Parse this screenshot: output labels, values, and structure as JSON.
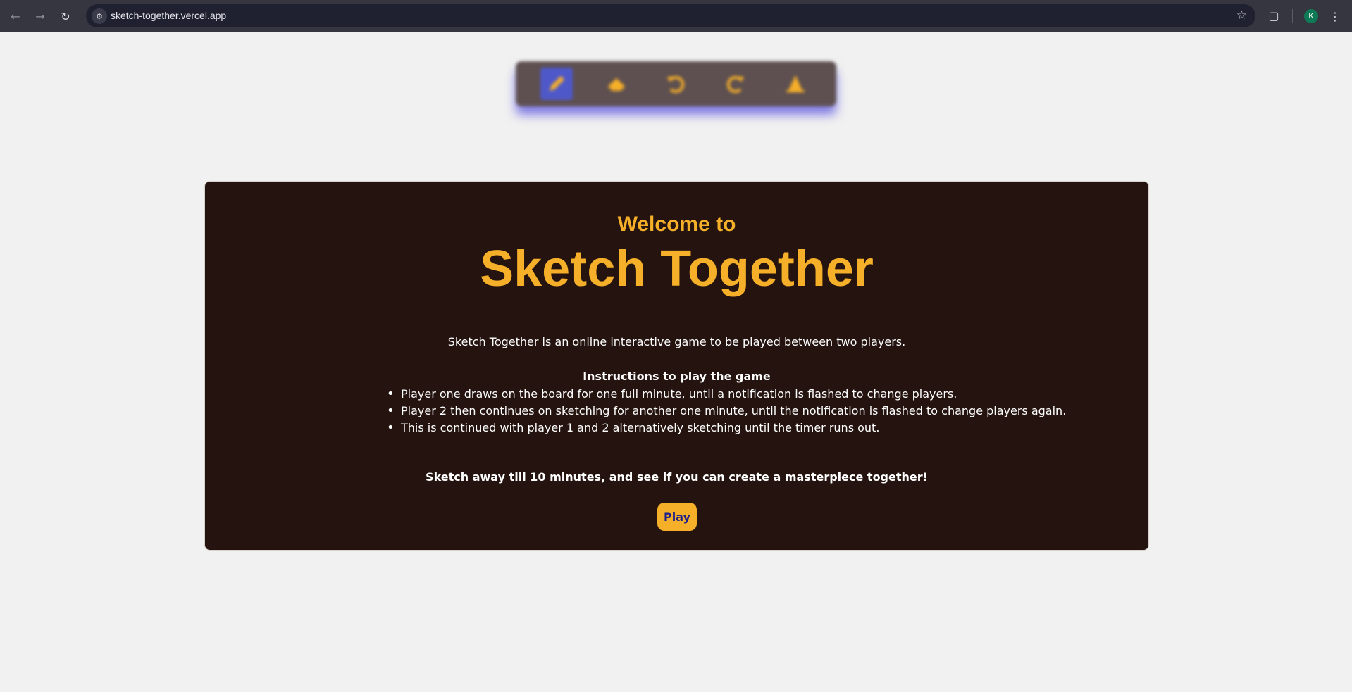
{
  "browser": {
    "url": "sketch-together.vercel.app",
    "profile_initial": "K",
    "icons": [
      "back-icon",
      "forward-icon",
      "reload-icon",
      "site-info-icon",
      "bookmark-star-icon",
      "extensions-icon",
      "more-menu-icon"
    ]
  },
  "toolbar": {
    "tools": [
      {
        "name": "pencil-tool",
        "icon": "pencil-icon",
        "active": true
      },
      {
        "name": "eraser-tool",
        "icon": "eraser-icon",
        "active": false
      },
      {
        "name": "undo-tool",
        "icon": "undo-icon",
        "active": false
      },
      {
        "name": "redo-tool",
        "icon": "redo-icon",
        "active": false
      },
      {
        "name": "clear-tool",
        "icon": "cone-icon",
        "active": false
      }
    ],
    "colors": {
      "background": "#5e5050",
      "icon": "#f6af28",
      "active": "#4f58c9",
      "glow": "#5c54e0"
    }
  },
  "card": {
    "welcome": "Welcome to",
    "title": "Sketch Together",
    "intro": "Sketch Together is an online interactive game to be played between two players.",
    "instructions_heading": "Instructions to play the game",
    "steps": [
      "Player one draws on the board for one full minute, until a notification is flashed to change players.",
      "Player 2 then continues on sketching for another one minute, until the notification is flashed to change players again.",
      "This is continued with player 1 and 2 alternatively sketching until the timer runs out."
    ],
    "cta": "Sketch away till 10 minutes, and see if you can create a masterpiece together!",
    "play_label": "Play"
  },
  "colors": {
    "accent": "#f6af28",
    "card_bg": "#24130e",
    "page_bg": "#f1f1f1",
    "play_text": "#1f1f8a"
  }
}
